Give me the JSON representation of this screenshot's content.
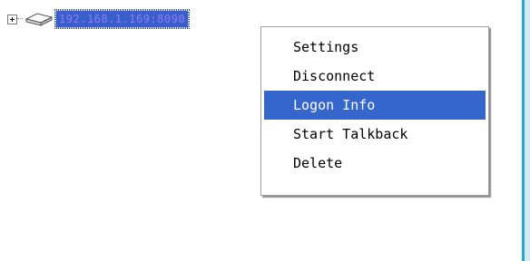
{
  "tree": {
    "node_label": "192.168.1.169:8090",
    "expander_icon": "plus-expander-icon",
    "device_icon": "device-icon"
  },
  "context_menu": {
    "items": [
      {
        "label": "Settings",
        "selected": false
      },
      {
        "label": "Disconnect",
        "selected": false
      },
      {
        "label": "Logon Info",
        "selected": true
      },
      {
        "label": "Start Talkback",
        "selected": false
      },
      {
        "label": "Delete",
        "selected": false
      }
    ]
  },
  "colors": {
    "selection": "#3466cc",
    "node_highlight": "#3a5fcd",
    "node_text": "#8f7bf0",
    "side_strip": "#28a7cf"
  }
}
